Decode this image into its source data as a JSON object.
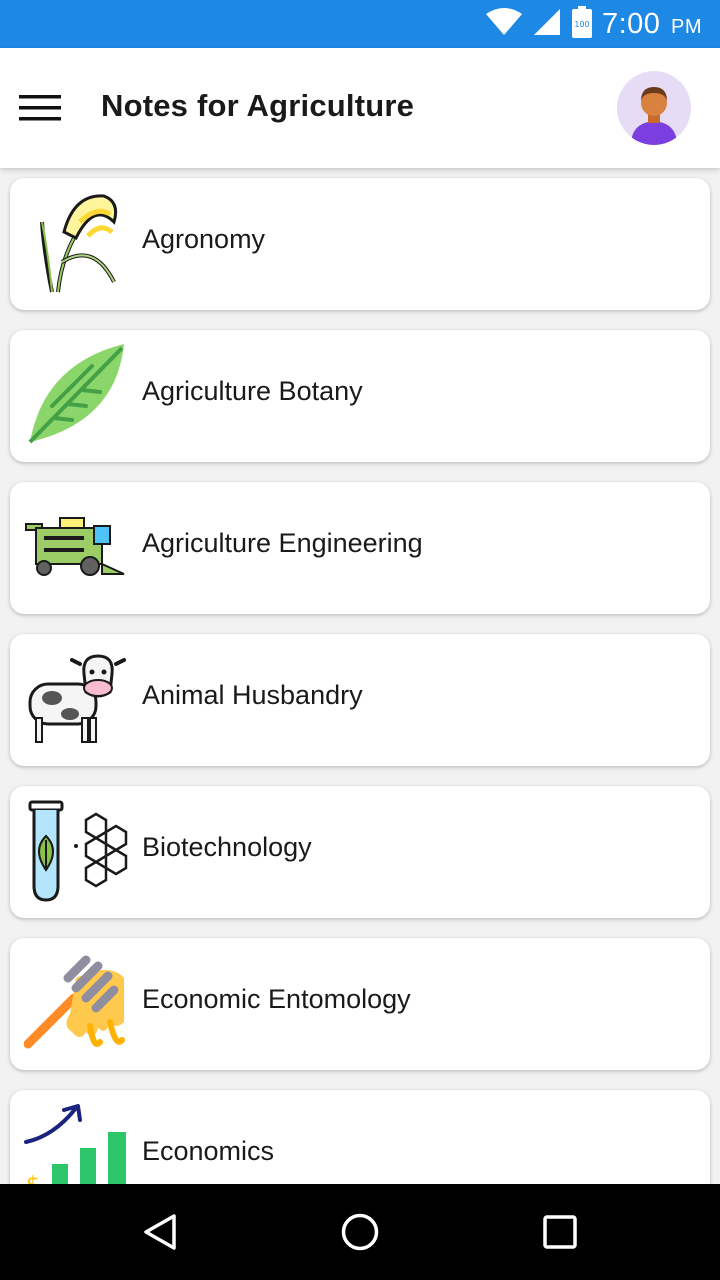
{
  "status_bar": {
    "time": "7:00",
    "ampm": "PM",
    "battery_level": "100",
    "icons": [
      "wifi-icon",
      "cellular-signal-icon",
      "battery-icon"
    ],
    "background_color": "#1e88e5"
  },
  "app_bar": {
    "title": "Notes for Agriculture",
    "menu_icon": "hamburger-menu-icon",
    "avatar_icon": "user-avatar-icon"
  },
  "categories": [
    {
      "label": "Agronomy",
      "icon": "wheat-icon"
    },
    {
      "label": "Agriculture Botany",
      "icon": "leaf-icon"
    },
    {
      "label": "Agriculture Engineering",
      "icon": "harvester-icon"
    },
    {
      "label": "Animal Husbandry",
      "icon": "cow-icon"
    },
    {
      "label": "Biotechnology",
      "icon": "test-tube-icon"
    },
    {
      "label": "Economic Entomology",
      "icon": "honey-dipper-icon"
    },
    {
      "label": "Economics",
      "icon": "growth-chart-icon"
    }
  ],
  "nav_bar": {
    "buttons": [
      "back-icon",
      "home-icon",
      "recents-icon"
    ]
  }
}
